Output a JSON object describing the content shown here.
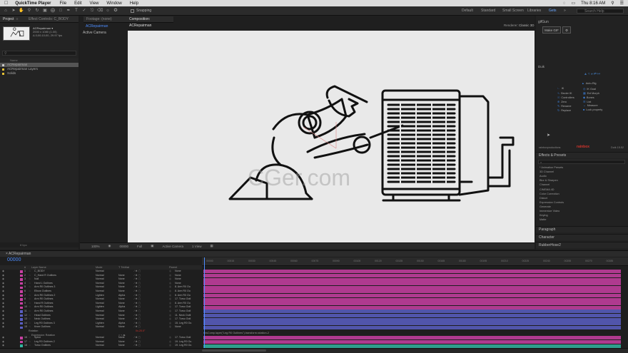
{
  "menubar": {
    "app_name": "QuickTime Player",
    "menus": [
      "File",
      "Edit",
      "View",
      "Window",
      "Help"
    ],
    "clock": "Thu 8:16 AM"
  },
  "toolbar": {
    "snapping_label": "Snapping",
    "workspaces": [
      "Default",
      "Standard",
      "Small Screen",
      "Libraries",
      "Gets"
    ],
    "active_workspace": "Gets",
    "search_placeholder": "Search Help"
  },
  "project_panel": {
    "tab_project": "Project",
    "tab_effect_controls": "Effect Controls: C_BODY",
    "comp_name": "ACRepairman ▾",
    "comp_info": [
      "2000 x 1080 (1.00)",
      "Δ 0;00;10;00, 29.97 fps"
    ],
    "column_name": "Name",
    "items": [
      "ACRepairman",
      "ACRepairman Layers",
      "Solids"
    ],
    "footer": "8 bpc"
  },
  "viewer": {
    "tab_footage": "Footage: (none)",
    "tab_composition": "Composition: ACRepairman",
    "breadcrumb": "ACRepairman",
    "active_camera": "Active Camera",
    "renderer_label": "Renderer:",
    "renderer_value": "Classic 3D",
    "zoom": "100%",
    "timecode": "00000",
    "resolution": "Full",
    "camera_menu": "Active Camera",
    "views": "1 View"
  },
  "watermark": "CGer.com",
  "right_panel": {
    "tab": "gifGun",
    "make_gif": "Make GIF",
    "duik_title": "Duik",
    "duik_items": [
      "Auto-Rig",
      "IK",
      "IK Goal",
      "Bezier IK",
      "Ext Morph",
      "Controllers",
      "Bones",
      "Zero",
      "List",
      "Rename",
      "Measure",
      "Replace",
      "Lock property"
    ],
    "brand": "rainbox",
    "duik_version": "Duik 15.52",
    "tabs_effects_header": "rainboxproductions",
    "effects_title": "Effects & Presets",
    "effects_search": "⌕",
    "effects_items": [
      "* Animation Presets",
      "3D Channel",
      "Audio",
      "Blur & Sharpen",
      "Channel",
      "CINEMA 4D",
      "Color Correction",
      "Distort",
      "Expression Controls",
      "Generate",
      "Immersive Video",
      "Keying",
      "Matte"
    ],
    "sections": [
      "Paragraph",
      "Character",
      "RubberHose2"
    ]
  },
  "timeline": {
    "tab": "ACRepairman",
    "timecode": "00000",
    "headers": {
      "num": "#",
      "layer_name": "Layer Name",
      "mode": "Mode",
      "trkmat": "T TrkMat",
      "parent": "Parent"
    },
    "layers": [
      {
        "num": "1",
        "name": "C_BODY",
        "mode": "Normal",
        "trk": "",
        "parent": "None",
        "color": "#c940a3"
      },
      {
        "num": "2",
        "name": "C_Hand R Outlines",
        "mode": "Normal",
        "trk": "None",
        "parent": "None",
        "color": "#c940a3"
      },
      {
        "num": "3",
        "name": "Null",
        "mode": "Normal",
        "trk": "None",
        "parent": "None",
        "color": "#c940a3"
      },
      {
        "num": "4",
        "name": "Hand L Outlines",
        "mode": "Normal",
        "trk": "None",
        "parent": "None",
        "color": "#c940a3"
      },
      {
        "num": "5",
        "name": "Arm R0 Outlines 3",
        "mode": "Normal",
        "trk": "None",
        "parent": "8. Arm R0 Ou",
        "color": "#c940a3"
      },
      {
        "num": "6",
        "name": "Elbow Outlines",
        "mode": "Normal",
        "trk": "None",
        "parent": "8. Arm R0 Ou",
        "color": "#c940a3"
      },
      {
        "num": "7",
        "name": "Arm R0 Outlines 2",
        "mode": "Lighten",
        "trk": "Alpha",
        "parent": "8. Arm R0 Ou",
        "color": "#c940a3"
      },
      {
        "num": "8",
        "name": "Arm R0 Outlines",
        "mode": "Normal",
        "trk": "None",
        "parent": "17. Torso Outl",
        "color": "#c940a3"
      },
      {
        "num": "9",
        "name": "Hand R Outlines",
        "mode": "Normal",
        "trk": "None",
        "parent": "8. Arm R0 Ou",
        "color": "#c940a3"
      },
      {
        "num": "10",
        "name": "Arm R0 Outlines",
        "mode": "Lighten",
        "trk": "Alpha",
        "parent": "17. Torso Outl",
        "color": "#c940a3"
      },
      {
        "num": "11",
        "name": "Arm R0 Outlines",
        "mode": "Normal",
        "trk": "None",
        "parent": "17. Torso Outl",
        "color": "#5a5fc4"
      },
      {
        "num": "12",
        "name": "Head Outlines",
        "mode": "Normal",
        "trk": "None",
        "parent": "11. Neck Outli",
        "color": "#5a5fc4"
      },
      {
        "num": "13",
        "name": "Neck Outlines",
        "mode": "Normal",
        "trk": "None",
        "parent": "17. Torso Outl",
        "color": "#5a5fc4"
      },
      {
        "num": "14",
        "name": "Leg R0 Outlines 3",
        "mode": "Lighten",
        "trk": "Alpha",
        "parent": "15. Leg R0 Ou",
        "color": "#5a5fc4"
      },
      {
        "num": "15",
        "name": "Knee Outlines",
        "mode": "Normal",
        "trk": "None",
        "parent": "None",
        "color": "#5a5fc4"
      }
    ],
    "sub_rows": [
      "Rotation",
      "Expression: Rotation"
    ],
    "rotation_value": "0x-20.0°",
    "layers2": [
      {
        "num": "16",
        "name": "Spine",
        "mode": "Normal",
        "trk": "None",
        "parent": "17. Torso Outl",
        "color": "#c940a3"
      },
      {
        "num": "17",
        "name": "Leg R0 Outlines 2",
        "mode": "Normal",
        "trk": "None",
        "parent": "19. Leg R0 Ou",
        "color": "#c940a3"
      },
      {
        "num": "18",
        "name": "Torso Outlines",
        "mode": "Normal",
        "trk": "None",
        "parent": "19. Leg R0 Ou",
        "color": "#33b5a0"
      }
    ],
    "expression_text": "thisComp.layer(\"Leg R0 Outlines\").transform.rotation-2",
    "ruler_labels": [
      "00000",
      "00015",
      "00030",
      "00045",
      "00060",
      "00075",
      "00090",
      "00105",
      "00120",
      "00135",
      "00150",
      "00165",
      "00180",
      "00195",
      "00210",
      "00225",
      "00240",
      "00255",
      "00270",
      "00285"
    ],
    "colors": {
      "pink": "#c940a3",
      "blue": "#5a5fc4",
      "teal": "#33b5a0",
      "accent": "#4d8dff"
    }
  }
}
